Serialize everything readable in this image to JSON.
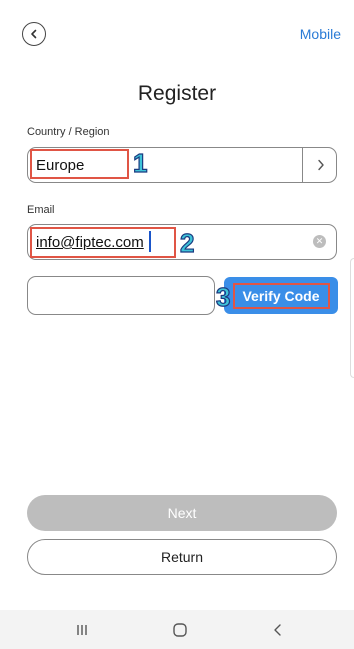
{
  "header": {
    "mobile_label": "Mobile",
    "back_icon": "chevron-left-icon"
  },
  "title": "Register",
  "country": {
    "label": "Country / Region",
    "value": "Europe",
    "chevron_icon": "chevron-right-icon"
  },
  "email": {
    "label": "Email",
    "value": "info@fiptec.com",
    "clear_icon": "clear-circle-icon"
  },
  "verify": {
    "code_value": "",
    "button_label": "Verify Code"
  },
  "annotations": {
    "step1": "1",
    "step2": "2",
    "step3": "3",
    "highlight_color": "#e05545",
    "number_color": "#3ec3d8"
  },
  "actions": {
    "next_label": "Next",
    "return_label": "Return"
  },
  "navbar": {
    "recent_icon": "recent-apps-icon",
    "home_icon": "home-icon",
    "back_icon": "nav-back-icon"
  },
  "colors": {
    "accent": "#3a8ee8",
    "link": "#2a7bd6",
    "disabled": "#bdbdbd"
  }
}
